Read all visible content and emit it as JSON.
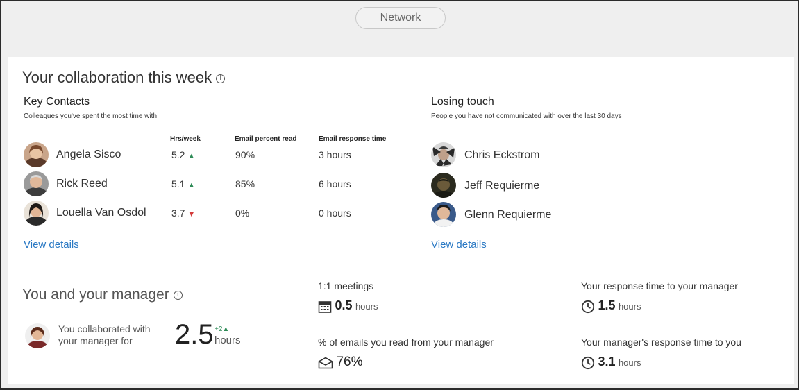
{
  "header": {
    "section_label": "Network"
  },
  "collaboration": {
    "title": "Your collaboration this week",
    "info_icon": "info-icon"
  },
  "key_contacts": {
    "title": "Key Contacts",
    "subtitle": "Colleagues you've spent the most time with",
    "columns": [
      "Hrs/week",
      "Email percent read",
      "Email response time"
    ],
    "rows": [
      {
        "name": "Angela Sisco",
        "hrs": "5.2",
        "trend": "up",
        "trend_glyph": "▲",
        "read": "90%",
        "response": "3 hours"
      },
      {
        "name": "Rick Reed",
        "hrs": "5.1",
        "trend": "up",
        "trend_glyph": "▲",
        "read": "85%",
        "response": "6 hours"
      },
      {
        "name": "Louella Van Osdol",
        "hrs": "3.7",
        "trend": "down",
        "trend_glyph": "▼",
        "read": "0%",
        "response": "0 hours"
      }
    ],
    "view_details": "View details"
  },
  "losing_touch": {
    "title": "Losing touch",
    "subtitle": "People you have not communicated with over the last 30 days",
    "people": [
      "Chris Eckstrom",
      "Jeff Requierme",
      "Glenn Requierme"
    ],
    "view_details": "View details"
  },
  "manager": {
    "title": "You and your manager",
    "collab_text_line1": "You collaborated with",
    "collab_text_line2": "your manager for",
    "hours_value": "2.5",
    "hours_delta": "+2",
    "hours_delta_glyph": "▲",
    "hours_unit": "hours",
    "meetings_label": "1:1 meetings",
    "meetings_value": "0.5",
    "meetings_unit": "hours",
    "emails_read_label": "% of emails you read from your manager",
    "emails_read_value": "76%",
    "your_response_label": "Your response time to your manager",
    "your_response_value": "1.5",
    "your_response_unit": "hours",
    "manager_response_label": "Your manager's response time to you",
    "manager_response_value": "3.1",
    "manager_response_unit": "hours"
  },
  "colors": {
    "link": "#2a79c4",
    "trend_up": "#2e8b57",
    "trend_down": "#d43b3b",
    "background": "#efefef",
    "card": "#ffffff"
  }
}
